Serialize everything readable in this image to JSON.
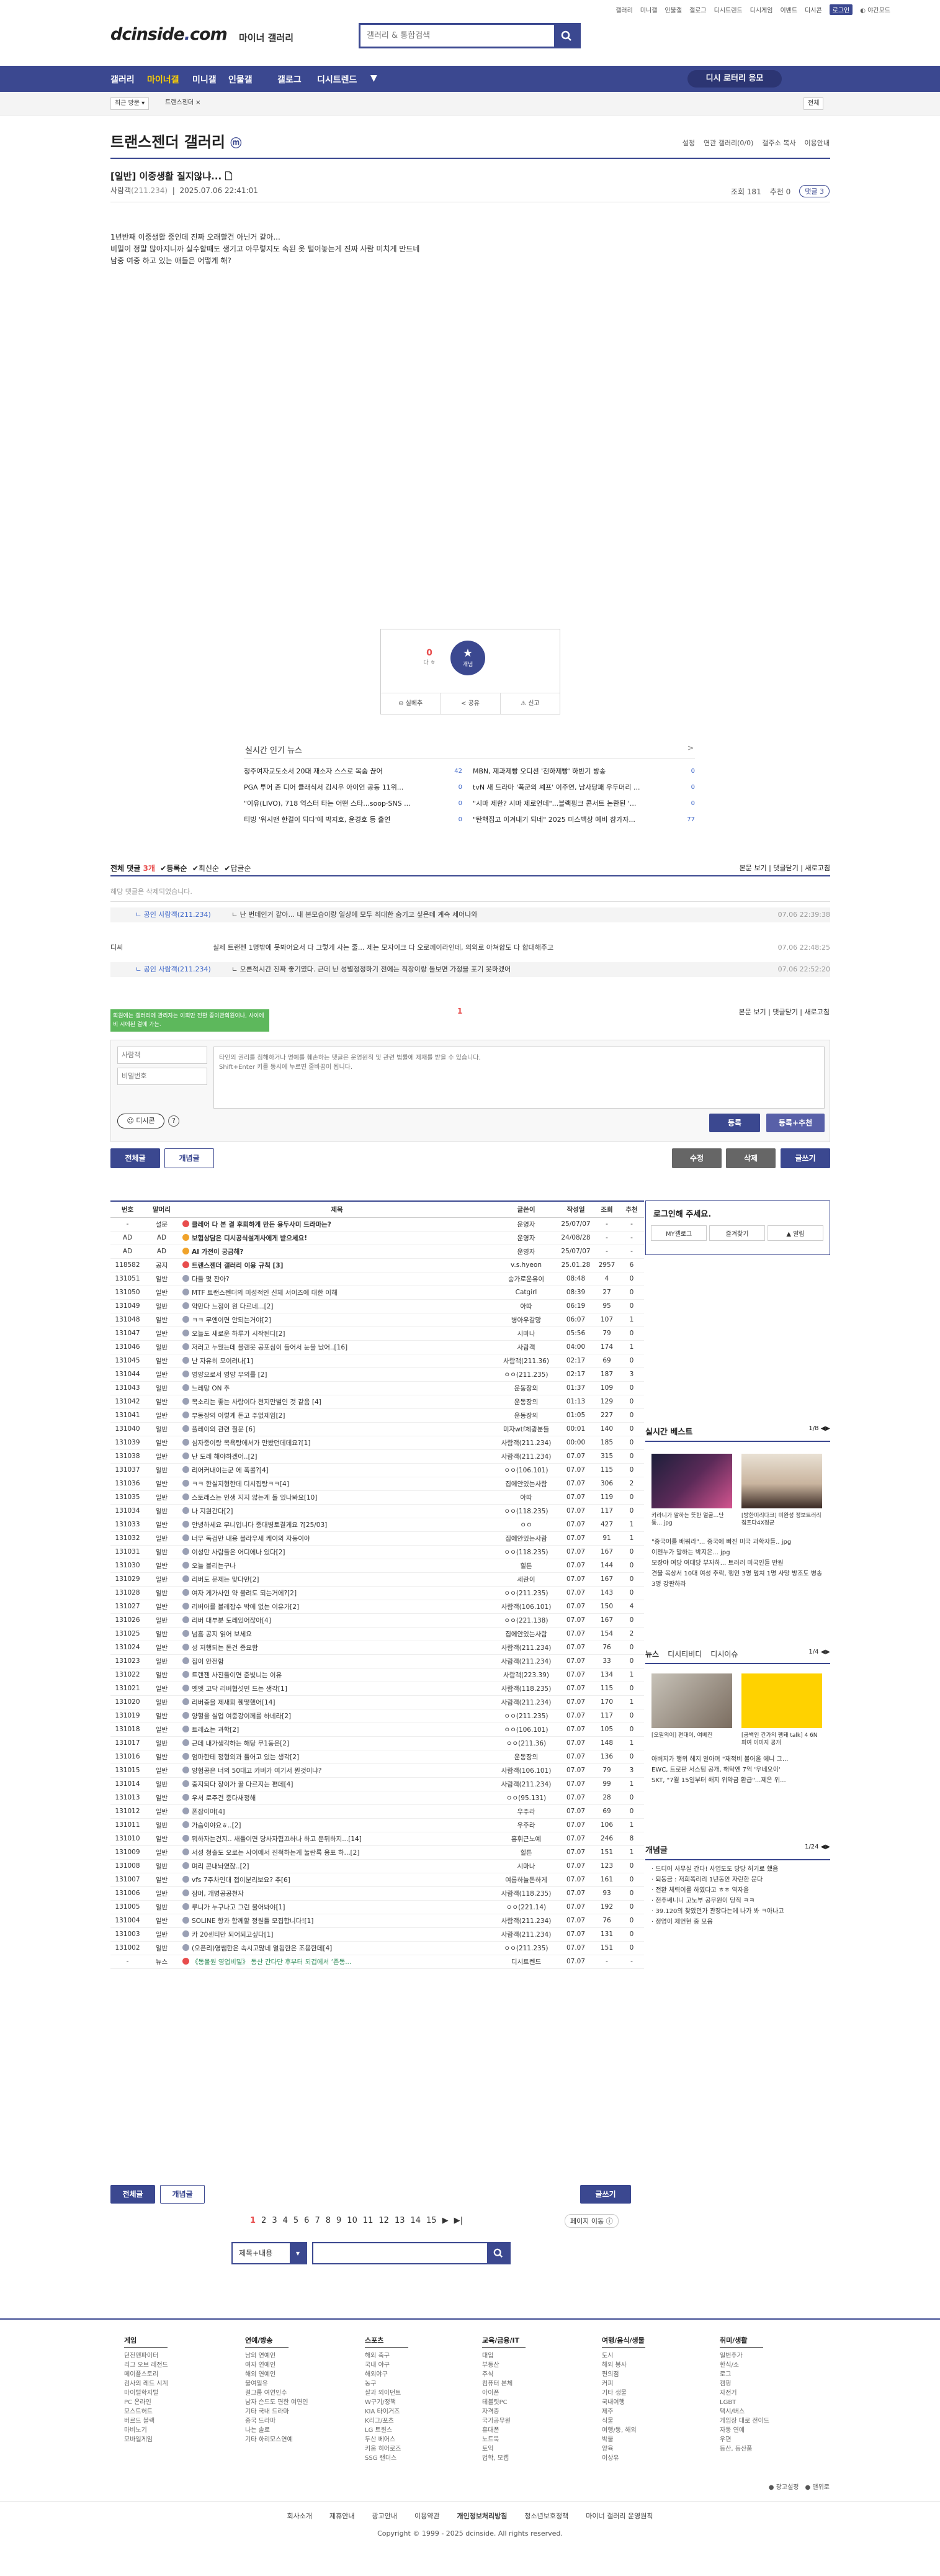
{
  "topnav": [
    "갤러리",
    "미니갤",
    "인물갤",
    "갤로그",
    "디시트렌드",
    "디시게임",
    "이벤트",
    "디시콘",
    "로그인",
    "야간모드"
  ],
  "logo": {
    "text": "dcinside",
    "dot": ".",
    "com": "com",
    "sub": "마이너 갤러리"
  },
  "search": {
    "placeholder": "갤러리 & 통합검색"
  },
  "gnb": [
    "갤러리",
    "마이너갤",
    "미니갤",
    "인물갤",
    "갤로그",
    "디시트렌드"
  ],
  "gnb_minihome": "디시 로터리 응모",
  "bar2": {
    "recent": "최근 방문",
    "gallery": "트랜스젠더",
    "all": "전체"
  },
  "gallery_title": "트랜스젠더 갤러리",
  "gallery_title_badge": "ⓜ",
  "gallery_opts": [
    "설정",
    "연관 갤러리(0/0)",
    "갤주소 복사",
    "이용안내"
  ],
  "post": {
    "title": "[일반] 이중생활 질지않냐... 🗋",
    "author": "사람객",
    "ip": "(211.234)",
    "date": "2025.07.06 22:41:01",
    "views": "조회 181",
    "rec": "추천 0",
    "comments": "댓글 3",
    "body": [
      "1년반째 이중생활 중인데 진짜 오래할건 아닌거 같아...",
      "비밀이 정말 많아지니까 실수할때도 생기고 아무렇지도 속된 옷 털어놓는게 진짜 사람 미치게 만드네",
      "남중 여중 하고 있는 애들은 어떻게 해?"
    ]
  },
  "reco": {
    "up": "0",
    "up_label": "다 ㅎ",
    "fix_label": "개념",
    "btns": [
      "실베추",
      "공유",
      "신고"
    ]
  },
  "hot": {
    "title": "실시간 인기 뉴스",
    "left": [
      [
        "청주여자교도소서 20대 재소자 스스로 목숨 끊어",
        "42"
      ],
      [
        "PGA 투어 존 디어 클래식서 김시우 아이언 공동 11위...",
        "0"
      ],
      [
        "\"이유(LIVO), 718 억스터 타는 어떤 스타...soop·SNS ...",
        "0"
      ],
      [
        "티빙 '워시맨 한걸이 되다'에 박지호, 윤경호 등 출연",
        "0"
      ]
    ],
    "right": [
      [
        "MBN, 제과제빵 오디션 '천하제빵' 하반기 방송",
        "0"
      ],
      [
        "tvN 새 드라마 '폭군의 셰프' 이주연, 남사당패 우두머리 ...",
        "0"
      ],
      [
        "\"시마 제한? 시마 제로언데\"...블랙핑크 콘서트 논란된 '...",
        "0"
      ],
      [
        "\"탄핵집고 이겨내기 되네\" 2025 미스백상 예비 참가자...",
        "77"
      ]
    ]
  },
  "cmt": {
    "label": "전체 댓글",
    "count": "3개",
    "sort": [
      "등록순",
      "최신순",
      "답글순"
    ],
    "right": [
      "본문 보기",
      "댓글닫기",
      "새로고침"
    ],
    "notice": "해당 댓글은 삭제되었습니다.",
    "rows": [
      {
        "nick": "ㄴ 공인 사람객(211.234)",
        "text": "ㄴ 난 번데인거 같아... 내 본모습이랑 일상에 모두 최대한 숨기고 싶은데 계속 세어나와",
        "date": "07.06 22:39:38"
      },
      {
        "nick": "디씨",
        "text": "실제 트랜젠 1명밖에 못봐어요서 다 그렇게 사는 줄... 제는 모자이크 다 오로께이라인데, 의외로 아쳐합도 다 합대해주고",
        "date": "07.06 22:48:25"
      },
      {
        "nick": "ㄴ 공인 사람객(211.234)",
        "text": "ㄴ 오른적시간 진짜 좋기였다. 근데 난 성별정정하기 전에는 직장이랑 돌보면 가정을 포기 못하겠어",
        "date": "07.06 22:52:20"
      }
    ],
    "page": "1",
    "tip": "회원에는 갤러리에 관리자는 이회만 전환 종이관회원이나, 사이에 비 시에된 걸에 가는.",
    "nick_ph": "사람객",
    "pw_ph": "비밀번호",
    "ta_ph": "타인의 권리를 침해하거나 명예를 훼손하는 댓글은 운영원칙 및 관련 법률에 제재를 받을 수 있습니다.\nShift+Enter 키를 동시에 누르면 줄바꿈이 됩니다.",
    "dccon": "디시콘",
    "submit": "등록",
    "submit2": "등록+추천"
  },
  "listbtns": {
    "all": "전체글",
    "best": "개념글",
    "edit": "수정",
    "del": "삭제",
    "write": "글쓰기"
  },
  "table": {
    "headers": [
      "번호",
      "말머리",
      "제목",
      "글쓴이",
      "작성일",
      "조회",
      "추천"
    ],
    "rows": [
      [
        "-",
        "설문",
        "클레어 다 본 결 후회하게 만든 용두사미 드라마는?",
        "운영자",
        "25/07/07",
        "-",
        "-",
        "n"
      ],
      [
        "AD",
        "AD",
        "보험상담은 디시공식설계사에게 받으세요!",
        "운영자",
        "24/08/28",
        "-",
        "-",
        "n"
      ],
      [
        "AD",
        "AD",
        "AI 가전이 궁금해?",
        "운영자",
        "25/07/07",
        "-",
        "-",
        "n"
      ],
      [
        "118582",
        "공지",
        "트랜스젠더 갤러리 이용 규칙 [3]",
        "v.s.hyeon",
        "25.01.28",
        "2957",
        "6",
        "n"
      ],
      [
        "131051",
        "일반",
        "다들 몇 잔아?",
        "숭가로운유이",
        "08:48",
        "4",
        "0"
      ],
      [
        "131050",
        "일반",
        "MTF 트랜스젠더의 미성적인 신체 서이즈에 대한 이해",
        "Catgirl",
        "08:39",
        "27",
        "0"
      ],
      [
        "131049",
        "일반",
        "약만다 느점이 왼 다르네...[2]",
        "아따",
        "06:19",
        "95",
        "0"
      ],
      [
        "131048",
        "일반",
        "ㅋㅋ 무엔이면 안되는거야[2]",
        "병아우갈망",
        "06:07",
        "107",
        "1"
      ],
      [
        "131047",
        "일반",
        "오늘도 새로운 하루가 시작된다[2]",
        "시마나",
        "05:56",
        "79",
        "0"
      ],
      [
        "131046",
        "일반",
        "저러고 누웠는데 블랜못 공포심이 들어서 눈물 났어..[16]",
        "사람객",
        "04:00",
        "174",
        "1"
      ],
      [
        "131045",
        "일반",
        "난 자유히 모이려나[1]",
        "사람객(211.36)",
        "02:17",
        "69",
        "0"
      ],
      [
        "131044",
        "일반",
        "영양으로서 영양 무의를 [2]",
        "ㅇㅇ(211.235)",
        "02:17",
        "187",
        "3"
      ],
      [
        "131043",
        "일반",
        "느레망 ON 추",
        "운동장의",
        "01:37",
        "109",
        "0"
      ],
      [
        "131042",
        "일반",
        "목소리는 좋는 사람이다 천지만별인 것 같음 [4]",
        "운동장의",
        "01:13",
        "129",
        "0"
      ],
      [
        "131041",
        "일반",
        "부동장의 이렇게 돈고 주없제임[2]",
        "운동장의",
        "01:05",
        "227",
        "0"
      ],
      [
        "131040",
        "일반",
        "플레이의 관련 질문 [6]",
        "미자wtf체광분들",
        "00:01",
        "140",
        "0"
      ],
      [
        "131039",
        "일반",
        "심자중이랑 목욕탕에서가 만봤던데데요?[1]",
        "사람객(211.234)",
        "00:00",
        "185",
        "0"
      ],
      [
        "131038",
        "일반",
        "난 도레 해야하겠어..[2]",
        "사람객(211.234)",
        "07.07",
        "315",
        "0"
      ],
      [
        "131037",
        "일반",
        "리어커내이는군 에 폭콜?[4]",
        "ㅇㅇ(106.101)",
        "07.07",
        "115",
        "0"
      ],
      [
        "131036",
        "일반",
        "ㅋㅋ 한실지형한데 디시집탕ㅋㅋ[4]",
        "집에안있는사람",
        "07.07",
        "306",
        "2"
      ],
      [
        "131035",
        "일반",
        "스토래스는 인생 지지 않는게 돌 있나봐요[10]",
        "아따",
        "07.07",
        "119",
        "0"
      ],
      [
        "131034",
        "일반",
        "나 지원간다[2]",
        "ㅇㅇ(118.235)",
        "07.07",
        "117",
        "0"
      ],
      [
        "131033",
        "일반",
        "안녕하세요 무니입니다 중대병토결게요 ?[25/03]",
        "ㅇㅇ",
        "07.07",
        "427",
        "1"
      ],
      [
        "131032",
        "일반",
        "너무 독검만 내용 블라우세 케이의 자동이야",
        "집에안있는사람",
        "07.07",
        "91",
        "1"
      ],
      [
        "131031",
        "일반",
        "이성만 사람들은 어디에나 있다[2]",
        "ㅇㅇ(118.235)",
        "07.07",
        "167",
        "0"
      ],
      [
        "131030",
        "일반",
        "오늘 블리는구나",
        "힐튼",
        "07.07",
        "144",
        "0"
      ],
      [
        "131029",
        "일반",
        "리버도 문제는 맞다만[2]",
        "세란이",
        "07.07",
        "167",
        "0"
      ],
      [
        "131028",
        "일반",
        "여자 게가사인 약 불려도 되는거에?[2]",
        "ㅇㅇ(211.235)",
        "07.07",
        "143",
        "0"
      ],
      [
        "131027",
        "일반",
        "리버어를 블레잡수 박에 없는 이유가[2]",
        "사람객(106.101)",
        "07.07",
        "150",
        "4"
      ],
      [
        "131026",
        "일반",
        "리버 대부분 도레있어잖아[4]",
        "ㅇㅇ(221.138)",
        "07.07",
        "167",
        "0"
      ],
      [
        "131025",
        "일반",
        "넘흠 공지 읽어 보세요",
        "집에안있는사람",
        "07.07",
        "154",
        "2"
      ],
      [
        "131024",
        "일반",
        "성 저행되는 돈건 종요함",
        "사람객(211.234)",
        "07.07",
        "76",
        "0"
      ],
      [
        "131023",
        "일반",
        "집이 안전함",
        "사람객(211.234)",
        "07.07",
        "33",
        "0"
      ],
      [
        "131022",
        "일반",
        "트랜젠 사진들이면 준빛니는 이유",
        "사람객(223.39)",
        "07.07",
        "134",
        "1"
      ],
      [
        "131021",
        "일반",
        "옛엣 고닥 리버협섯민 드는 생각[1]",
        "사람객(118.235)",
        "07.07",
        "115",
        "0"
      ],
      [
        "131020",
        "일반",
        "리버증을 제새회 휀떻했어[14]",
        "사람객(211.234)",
        "07.07",
        "170",
        "1"
      ],
      [
        "131019",
        "일반",
        "양헐을 실업 여중강이께를 하네라[2]",
        "ㅇㅇ(211.235)",
        "07.07",
        "117",
        "0"
      ],
      [
        "131018",
        "일반",
        "트레쇼는 과학[2]",
        "ㅇㅇ(106.101)",
        "07.07",
        "105",
        "0"
      ],
      [
        "131017",
        "일반",
        "근데 내가생각하는 해당 무1동은[2]",
        "ㅇㅇ(211.36)",
        "07.07",
        "148",
        "1"
      ],
      [
        "131016",
        "일반",
        "엄마한테 정형외과 들어고 있는 생각[2]",
        "운동장의",
        "07.07",
        "136",
        "0"
      ],
      [
        "131015",
        "일반",
        "양험공은 너의 50대고 카버가 여기서 뭔것이냐?",
        "사람객(106.101)",
        "07.07",
        "79",
        "3"
      ],
      [
        "131014",
        "일반",
        "중지되다 장이가 꿀 다르지는 편데[4]",
        "사람객(211.234)",
        "07.07",
        "99",
        "1"
      ],
      [
        "131013",
        "일반",
        "우서 로주건 중다새정해",
        "ㅇㅇ(95.131)",
        "07.07",
        "28",
        "0"
      ],
      [
        "131012",
        "일반",
        "폰잡이야[4]",
        "우주라",
        "07.07",
        "69",
        "0"
      ],
      [
        "131011",
        "일반",
        "가슴이야요ㅎ..[2]",
        "우주라",
        "07.07",
        "106",
        "1"
      ],
      [
        "131010",
        "일반",
        "뭐하자는건지.. 새들이면 당사자협끄하나 하고 문뒤하지...[14]",
        "홍휘근노예",
        "07.07",
        "246",
        "8"
      ],
      [
        "131009",
        "일반",
        "서성 청출도 오로는 사이에서 진척하는게 눌란록 용포 하...[2]",
        "힐튼",
        "07.07",
        "151",
        "1"
      ],
      [
        "131008",
        "일반",
        "며리 콘내놔였잖..[2]",
        "시마나",
        "07.07",
        "123",
        "0"
      ],
      [
        "131007",
        "일반",
        "vfs 7주차인대 접이분리보요? 추[6]",
        "여름하늘돈하게",
        "07.07",
        "161",
        "0"
      ],
      [
        "131006",
        "일반",
        "잠머, 개명공공천자",
        "사람객(118.235)",
        "07.07",
        "93",
        "0"
      ],
      [
        "131005",
        "일반",
        "루니가 누구나고 그런 물어봐야[1]",
        "ㅇㅇ(221.14)",
        "07.07",
        "192",
        "0"
      ],
      [
        "131004",
        "일반",
        "SOLINE 항과 함께할 정원들 모집합니다![1]",
        "사람객(211.234)",
        "07.07",
        "76",
        "0"
      ],
      [
        "131003",
        "일반",
        "카 20센티만 되어되고싶다[1]",
        "사람객(211.234)",
        "07.07",
        "131",
        "0"
      ],
      [
        "131002",
        "일반",
        "(오픈리)영쌤한은 속시고많네 열됩한은 조용한데[4]",
        "ㅇㅇ(211.235)",
        "07.07",
        "151",
        "0"
      ],
      [
        "-",
        "뉴스",
        "《동물원 영업비밀》 동산 간다단 후부터 되겁에서 ‘존동...",
        "디시트렌드",
        "07.07",
        "-",
        "-",
        "news"
      ]
    ]
  },
  "pagination": {
    "pages": [
      "1",
      "2",
      "3",
      "4",
      "5",
      "6",
      "7",
      "8",
      "9",
      "10",
      "11",
      "12",
      "13",
      "14",
      "15"
    ],
    "next": "페이지 이동 ⓘ"
  },
  "searchbar": {
    "select": "제목+내용"
  },
  "side": {
    "login_title": "로그인해 주세요.",
    "login_btns": [
      "MY갤로그",
      "즐겨찾기",
      "알림"
    ],
    "best_title": "실시간 베스트",
    "best_page": "1/8",
    "best_caps": [
      "카라니가 말하는 뜻한 얼굴...단동... jpg",
      "[방한미리다크] 미완성 정보트러리점프다4X정군"
    ],
    "best_list": [
      "\"중국어를 배워라\"... 중국에 빠진 미국 과학자들.. jpg",
      "이젠누가 말하는 박지은... jpg",
      "모장야 여당 여대당 부자하... 트러러 미국인들 반원",
      "견불 옥상서 10대 여성 추락, 행인 3명 덮쳐 1명 사망 방조도 병송3명 강판하라"
    ],
    "news_tabs": [
      "뉴스",
      "디시티비디",
      "디시이슈"
    ],
    "news_page": "1/4",
    "news_caps": [
      "[오필의이] 편대이, 여베진",
      "[공백인 간가의 펭돼 talk] 4 6N 피여 이미지 공개"
    ],
    "news_list": [
      "아버지가 행위 헤지 알아며 \"재적비 불어울 에니 그...",
      "EWC, 트로판 서스팀 공개, 해탁엔 7억 '우네오이'",
      "SKT, \"7월 15일부터 해지 위약금 환급\"...제은 위..."
    ],
    "gaenyeom_title": "개념글",
    "gaenyeom_page": "1/24",
    "gaenyeom_list": [
      "드디어 사무실 간다! 사업도도 당당 허기로 했음",
      "퇴동금 : 저희쪽리리 1년동안 자린한 문다",
      "전환 체력이를 하였다고 ㅎㅎ 역자을",
      "전추쎄니니 고노부 공무원이 당직 ㅋㅋ",
      "39.120의 찾았던가 관장다는에 나가 봐 ㅋ아나고",
      "정영이 제언현 중 모음"
    ]
  },
  "footer": {
    "cols": [
      {
        "h": "게임",
        "items": [
          "던전앤파이터",
          "리그 오브 레전드",
          "메이플스토리",
          "검사의 레드 시계",
          "마이털학지털",
          "PC 온라인",
          "모스트허트",
          "버르드 블랙",
          "마비노기",
          "모바일게임"
        ]
      },
      {
        "h": "연예/방송",
        "items": [
          "남의 연예인",
          "여자 연예인",
          "해외 연예인",
          "불여밀유",
          "걸그룹 여연인수",
          "남자 슨드도 편한 여연인",
          "기타 국내 드라마",
          "중국 드라마",
          "나는 솔로",
          "기타 하리모스연예"
        ]
      },
      {
        "h": "스포츠",
        "items": [
          "해외 축구",
          "국내 야구",
          "해외야구",
          "농구",
          "살과 외이던트",
          "W구기/정책",
          "KIA 타이거즈",
          "K리그/포츠",
          "LG 트윈스",
          "두산 베어스",
          "키움 히어로즈",
          "SSG 랜더스"
        ]
      },
      {
        "h": "교육/금융/IT",
        "items": [
          "대입",
          "부동산",
          "주식",
          "컴퓨터 본체",
          "아이폰",
          "테블릿PC",
          "자격증",
          "국가공무원",
          "휴대폰",
          "노트북",
          "토익",
          "법학, 모랩"
        ]
      },
      {
        "h": "여행/음식/생물",
        "items": [
          "도시",
          "해외 봉사",
          "편의점",
          "커피",
          "기타 생물",
          "국내여행",
          "제주",
          "식물",
          "여행/동, 해외",
          "박물",
          "양육",
          "이상유"
        ]
      },
      {
        "h": "취미/생활",
        "items": [
          "일번추가",
          "한식/소",
          "로그",
          "캠핑",
          "자전거",
          "LGBT",
          "택시/버스",
          "게임장 대로 전이드",
          "자동 연예",
          "우편",
          "등산, 등산품"
        ]
      }
    ],
    "links": [
      "회사소개",
      "제휴안내",
      "광고안내",
      "이용약관",
      "개인정보처리방침",
      "청소년보호정책",
      "마이너 갤러리 운영원칙"
    ],
    "copy": "Copyright © 1999 - 2025 dcinside. All rights reserved.",
    "side_links": [
      "● 광고설정",
      "● 맨위로"
    ]
  }
}
